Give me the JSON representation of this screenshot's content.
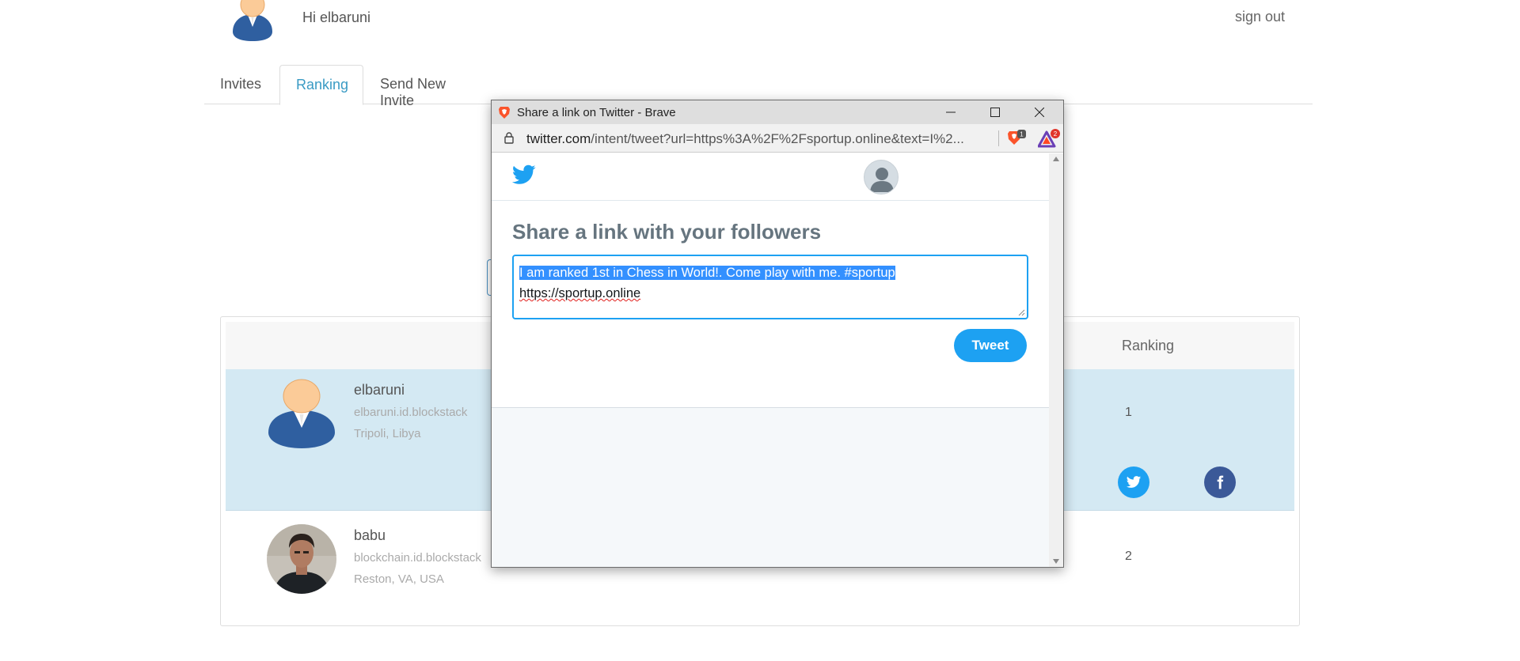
{
  "header": {
    "greeting": "Hi elbaruni",
    "signout_label": "sign out"
  },
  "tabs": [
    {
      "label": "Invites",
      "active": false
    },
    {
      "label": "Ranking",
      "active": true
    },
    {
      "label": "Send New Invite",
      "active": false
    }
  ],
  "ranking": {
    "column_header": "Ranking",
    "rows": [
      {
        "name": "elbaruni",
        "handle": "elbaruni.id.blockstack",
        "location": "Tripoli, Libya",
        "rank": "1",
        "highlighted": true
      },
      {
        "name": "babu",
        "handle": "blockchain.id.blockstack",
        "location": "Reston, VA, USA",
        "rank": "2",
        "highlighted": false
      }
    ]
  },
  "popup": {
    "window_title": "Share a link on Twitter - Brave",
    "url_domain": "twitter.com",
    "url_path": "/intent/tweet?url=https%3A%2F%2Fsportup.online&text=I%2...",
    "shield_badge": "1",
    "rewards_badge": "2",
    "heading": "Share a link with your followers",
    "tweet_text_line1": "I am ranked 1st in Chess in World!. Come play with me. #sportup",
    "tweet_text_line2": "https://sportup.online",
    "tweet_button": "Tweet"
  },
  "colors": {
    "accent": "#3a9bc4",
    "highlight_row": "#d4e9f3",
    "twitter_blue": "#1da1f2",
    "facebook_blue": "#3b5998"
  }
}
